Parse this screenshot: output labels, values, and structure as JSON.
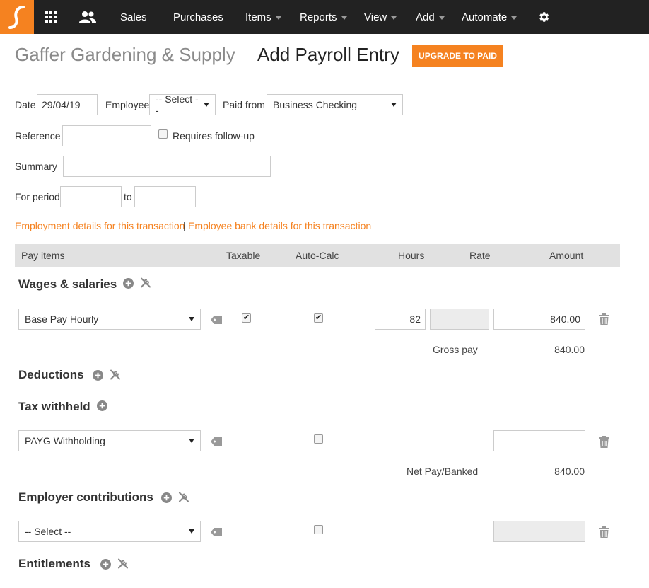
{
  "nav": {
    "items": [
      {
        "label": "Sales",
        "dropdown": false
      },
      {
        "label": "Purchases",
        "dropdown": false
      },
      {
        "label": "Items",
        "dropdown": true
      },
      {
        "label": "Reports",
        "dropdown": true
      },
      {
        "label": "View",
        "dropdown": true
      },
      {
        "label": "Add",
        "dropdown": true
      },
      {
        "label": "Automate",
        "dropdown": true
      }
    ],
    "icons": [
      "logo-icon",
      "apps-grid-icon",
      "people-icon",
      "gear-icon"
    ]
  },
  "header": {
    "company": "Gaffer Gardening & Supply",
    "title": "Add Payroll Entry",
    "upgrade_label": "UPGRADE TO PAID"
  },
  "form": {
    "date_label": "Date",
    "date_value": "29/04/19",
    "employee_label": "Employee",
    "employee_value": "-- Select --",
    "paid_from_label": "Paid from",
    "paid_from_value": "Business Checking",
    "reference_label": "Reference",
    "reference_value": "",
    "followup_label": "Requires follow-up",
    "followup_checked": false,
    "summary_label": "Summary",
    "summary_value": "",
    "period_label": "For period",
    "period_to_label": "to",
    "period_from_value": "",
    "period_to_value": ""
  },
  "links": {
    "employment": "Employment details for this transaction",
    "separator": "|",
    "bank": "Employee bank details for this transaction"
  },
  "table": {
    "headers": {
      "pay_items": "Pay items",
      "taxable": "Taxable",
      "autocalc": "Auto-Calc",
      "hours": "Hours",
      "rate": "Rate",
      "amount": "Amount"
    }
  },
  "sections": {
    "wages": {
      "title": "Wages & salaries",
      "row": {
        "item": "Base Pay Hourly",
        "taxable": true,
        "autocalc": true,
        "hours": "82",
        "rate": "",
        "amount": "840.00"
      },
      "total_label": "Gross pay",
      "total_value": "840.00"
    },
    "deductions": {
      "title": "Deductions"
    },
    "tax": {
      "title": "Tax withheld",
      "row": {
        "item": "PAYG Withholding",
        "autocalc": false,
        "amount": ""
      },
      "total_label": "Net Pay/Banked",
      "total_value": "840.00"
    },
    "employer": {
      "title": "Employer contributions",
      "row": {
        "item": "-- Select --",
        "autocalc": false,
        "amount": ""
      }
    },
    "entitlements": {
      "title": "Entitlements"
    }
  },
  "colors": {
    "accent": "#f58220",
    "navbar": "#222222",
    "table_header": "#e1e1e1"
  }
}
